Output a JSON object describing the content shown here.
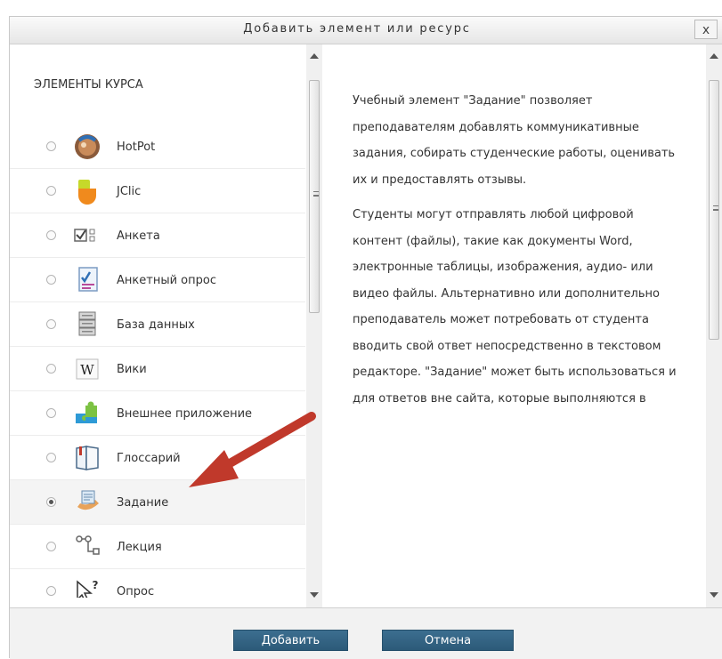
{
  "dialog": {
    "title": "Добавить элемент или ресурс",
    "close_label": "x"
  },
  "left": {
    "section_title": "ЭЛЕМЕНТЫ КУРСА",
    "items": [
      {
        "label": "HotPot",
        "icon": "hotpot-icon"
      },
      {
        "label": "JClic",
        "icon": "jclic-icon"
      },
      {
        "label": "Анкета",
        "icon": "survey-icon"
      },
      {
        "label": "Анкетный опрос",
        "icon": "questionnaire-icon"
      },
      {
        "label": "База данных",
        "icon": "database-icon"
      },
      {
        "label": "Вики",
        "icon": "wiki-icon"
      },
      {
        "label": "Внешнее приложение",
        "icon": "puzzle-icon"
      },
      {
        "label": "Глоссарий",
        "icon": "glossary-icon"
      },
      {
        "label": "Задание",
        "icon": "assignment-icon",
        "selected": true
      },
      {
        "label": "Лекция",
        "icon": "lesson-icon"
      },
      {
        "label": "Опрос",
        "icon": "choice-icon"
      }
    ]
  },
  "description": {
    "paragraphs": [
      "Учебный элемент \"Задание\" позволяет преподавателям добавлять коммуникативные задания, собирать студенческие работы, оценивать их и предоставлять отзывы.",
      "Студенты могут отправлять любой цифровой контент (файлы), такие как документы Word, электронные таблицы, изображения, аудио- или видео файлы. Альтернативно или дополнительно преподаватель может потребовать от студента вводить свой ответ непосредственно в текстовом редакторе. \"Задание\" может быть использоваться и для ответов вне сайта, которые выполняются в"
    ]
  },
  "footer": {
    "add_label": "Добавить",
    "cancel_label": "Отмена"
  },
  "colors": {
    "button_bg": "#2f5f80",
    "annotation_arrow": "#c0392b"
  }
}
